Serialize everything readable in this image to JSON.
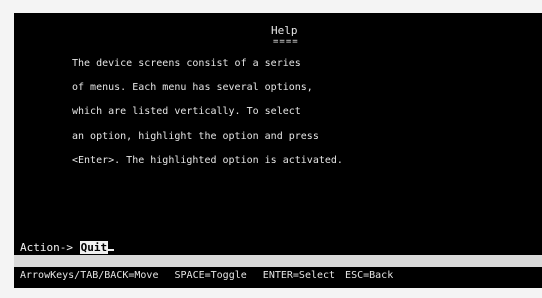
{
  "help": {
    "title": "Help",
    "underline": "====",
    "lines": [
      "The device screens consist of a series",
      "of menus. Each menu has several options,",
      "which are listed vertically. To select",
      "an option, highlight the option and press",
      "<Enter>. The highlighted option is activated."
    ]
  },
  "action": {
    "label": "Action->",
    "value": "Quit"
  },
  "status_bar": {
    "items": [
      "ArrowKeys/TAB/BACK=Move",
      "SPACE=Toggle",
      "ENTER=Select",
      "ESC=Back"
    ]
  },
  "colors": {
    "screen_background": "#000000",
    "text": "#e6e6e6",
    "highlight_background": "#f0f0f0",
    "separator": "#d9d9d9"
  }
}
